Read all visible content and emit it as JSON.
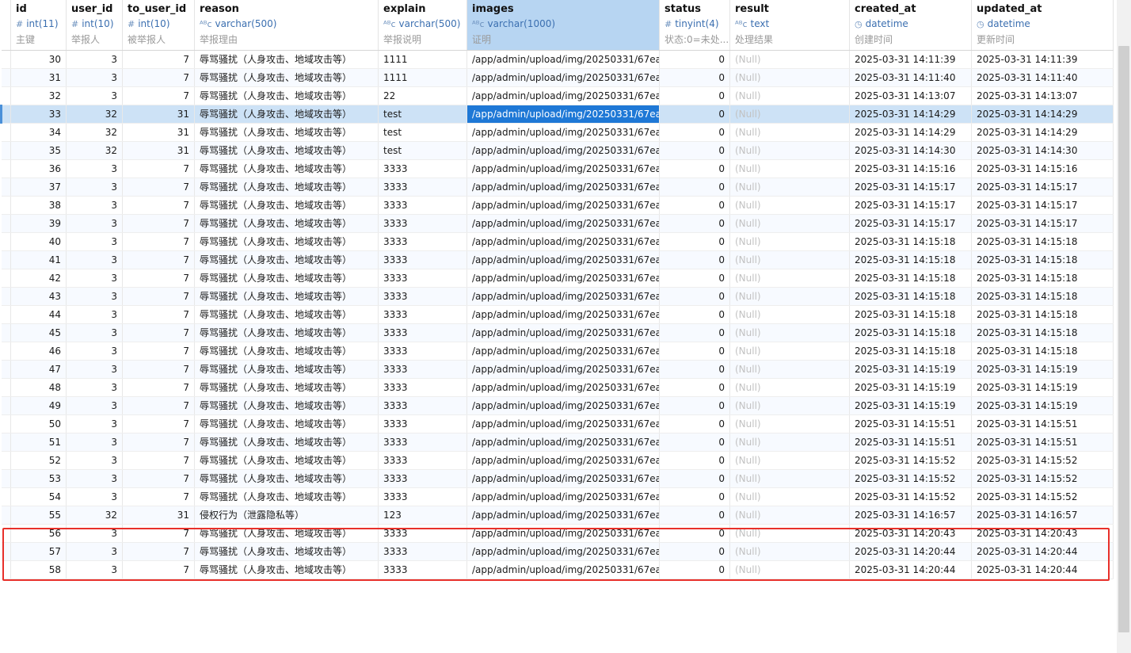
{
  "columns": [
    {
      "name": "id",
      "type": "int(11)",
      "type_icon": "#",
      "comment": "主键",
      "align": "num"
    },
    {
      "name": "user_id",
      "type": "int(10)",
      "type_icon": "#",
      "comment": "举报人",
      "align": "num"
    },
    {
      "name": "to_user_id",
      "type": "int(10)",
      "type_icon": "#",
      "comment": "被举报人",
      "align": "num"
    },
    {
      "name": "reason",
      "type": "varchar(500)",
      "type_icon": "ABC",
      "comment": "举报理由",
      "align": "text"
    },
    {
      "name": "explain",
      "type": "varchar(500)",
      "type_icon": "ABC",
      "comment": "举报说明",
      "align": "text"
    },
    {
      "name": "images",
      "type": "varchar(1000)",
      "type_icon": "ABC",
      "comment": "证明",
      "align": "text"
    },
    {
      "name": "status",
      "type": "tinyint(4)",
      "type_icon": "#",
      "comment": "状态:0=未处...",
      "align": "num"
    },
    {
      "name": "result",
      "type": "text",
      "type_icon": "ABC",
      "comment": "处理结果",
      "align": "text"
    },
    {
      "name": "created_at",
      "type": "datetime",
      "type_icon": "clock",
      "comment": "创建时间",
      "align": "text"
    },
    {
      "name": "updated_at",
      "type": "datetime",
      "type_icon": "clock",
      "comment": "更新时间",
      "align": "text"
    }
  ],
  "selected_column": "images",
  "current_row_id": "33",
  "null_text": "(Null)",
  "rows": [
    [
      "30",
      "3",
      "7",
      "辱骂骚扰（人身攻击、地域攻击等）",
      "1111",
      "/app/admin/upload/img/20250331/67ea",
      "0",
      "(Null)",
      "2025-03-31 14:11:39",
      "2025-03-31 14:11:39"
    ],
    [
      "31",
      "3",
      "7",
      "辱骂骚扰（人身攻击、地域攻击等）",
      "1111",
      "/app/admin/upload/img/20250331/67ea",
      "0",
      "(Null)",
      "2025-03-31 14:11:40",
      "2025-03-31 14:11:40"
    ],
    [
      "32",
      "3",
      "7",
      "辱骂骚扰（人身攻击、地域攻击等）",
      "22",
      "/app/admin/upload/img/20250331/67ea",
      "0",
      "(Null)",
      "2025-03-31 14:13:07",
      "2025-03-31 14:13:07"
    ],
    [
      "33",
      "32",
      "31",
      "辱骂骚扰（人身攻击、地域攻击等）",
      "test",
      "/app/admin/upload/img/20250331/67ea",
      "0",
      "(Null)",
      "2025-03-31 14:14:29",
      "2025-03-31 14:14:29"
    ],
    [
      "34",
      "32",
      "31",
      "辱骂骚扰（人身攻击、地域攻击等）",
      "test",
      "/app/admin/upload/img/20250331/67ea",
      "0",
      "(Null)",
      "2025-03-31 14:14:29",
      "2025-03-31 14:14:29"
    ],
    [
      "35",
      "32",
      "31",
      "辱骂骚扰（人身攻击、地域攻击等）",
      "test",
      "/app/admin/upload/img/20250331/67ea",
      "0",
      "(Null)",
      "2025-03-31 14:14:30",
      "2025-03-31 14:14:30"
    ],
    [
      "36",
      "3",
      "7",
      "辱骂骚扰（人身攻击、地域攻击等）",
      "3333",
      "/app/admin/upload/img/20250331/67ea",
      "0",
      "(Null)",
      "2025-03-31 14:15:16",
      "2025-03-31 14:15:16"
    ],
    [
      "37",
      "3",
      "7",
      "辱骂骚扰（人身攻击、地域攻击等）",
      "3333",
      "/app/admin/upload/img/20250331/67ea",
      "0",
      "(Null)",
      "2025-03-31 14:15:17",
      "2025-03-31 14:15:17"
    ],
    [
      "38",
      "3",
      "7",
      "辱骂骚扰（人身攻击、地域攻击等）",
      "3333",
      "/app/admin/upload/img/20250331/67ea",
      "0",
      "(Null)",
      "2025-03-31 14:15:17",
      "2025-03-31 14:15:17"
    ],
    [
      "39",
      "3",
      "7",
      "辱骂骚扰（人身攻击、地域攻击等）",
      "3333",
      "/app/admin/upload/img/20250331/67ea",
      "0",
      "(Null)",
      "2025-03-31 14:15:17",
      "2025-03-31 14:15:17"
    ],
    [
      "40",
      "3",
      "7",
      "辱骂骚扰（人身攻击、地域攻击等）",
      "3333",
      "/app/admin/upload/img/20250331/67ea",
      "0",
      "(Null)",
      "2025-03-31 14:15:18",
      "2025-03-31 14:15:18"
    ],
    [
      "41",
      "3",
      "7",
      "辱骂骚扰（人身攻击、地域攻击等）",
      "3333",
      "/app/admin/upload/img/20250331/67ea",
      "0",
      "(Null)",
      "2025-03-31 14:15:18",
      "2025-03-31 14:15:18"
    ],
    [
      "42",
      "3",
      "7",
      "辱骂骚扰（人身攻击、地域攻击等）",
      "3333",
      "/app/admin/upload/img/20250331/67ea",
      "0",
      "(Null)",
      "2025-03-31 14:15:18",
      "2025-03-31 14:15:18"
    ],
    [
      "43",
      "3",
      "7",
      "辱骂骚扰（人身攻击、地域攻击等）",
      "3333",
      "/app/admin/upload/img/20250331/67ea",
      "0",
      "(Null)",
      "2025-03-31 14:15:18",
      "2025-03-31 14:15:18"
    ],
    [
      "44",
      "3",
      "7",
      "辱骂骚扰（人身攻击、地域攻击等）",
      "3333",
      "/app/admin/upload/img/20250331/67ea",
      "0",
      "(Null)",
      "2025-03-31 14:15:18",
      "2025-03-31 14:15:18"
    ],
    [
      "45",
      "3",
      "7",
      "辱骂骚扰（人身攻击、地域攻击等）",
      "3333",
      "/app/admin/upload/img/20250331/67ea",
      "0",
      "(Null)",
      "2025-03-31 14:15:18",
      "2025-03-31 14:15:18"
    ],
    [
      "46",
      "3",
      "7",
      "辱骂骚扰（人身攻击、地域攻击等）",
      "3333",
      "/app/admin/upload/img/20250331/67ea",
      "0",
      "(Null)",
      "2025-03-31 14:15:18",
      "2025-03-31 14:15:18"
    ],
    [
      "47",
      "3",
      "7",
      "辱骂骚扰（人身攻击、地域攻击等）",
      "3333",
      "/app/admin/upload/img/20250331/67ea",
      "0",
      "(Null)",
      "2025-03-31 14:15:19",
      "2025-03-31 14:15:19"
    ],
    [
      "48",
      "3",
      "7",
      "辱骂骚扰（人身攻击、地域攻击等）",
      "3333",
      "/app/admin/upload/img/20250331/67ea",
      "0",
      "(Null)",
      "2025-03-31 14:15:19",
      "2025-03-31 14:15:19"
    ],
    [
      "49",
      "3",
      "7",
      "辱骂骚扰（人身攻击、地域攻击等）",
      "3333",
      "/app/admin/upload/img/20250331/67ea",
      "0",
      "(Null)",
      "2025-03-31 14:15:19",
      "2025-03-31 14:15:19"
    ],
    [
      "50",
      "3",
      "7",
      "辱骂骚扰（人身攻击、地域攻击等）",
      "3333",
      "/app/admin/upload/img/20250331/67ea",
      "0",
      "(Null)",
      "2025-03-31 14:15:51",
      "2025-03-31 14:15:51"
    ],
    [
      "51",
      "3",
      "7",
      "辱骂骚扰（人身攻击、地域攻击等）",
      "3333",
      "/app/admin/upload/img/20250331/67ea",
      "0",
      "(Null)",
      "2025-03-31 14:15:51",
      "2025-03-31 14:15:51"
    ],
    [
      "52",
      "3",
      "7",
      "辱骂骚扰（人身攻击、地域攻击等）",
      "3333",
      "/app/admin/upload/img/20250331/67ea",
      "0",
      "(Null)",
      "2025-03-31 14:15:52",
      "2025-03-31 14:15:52"
    ],
    [
      "53",
      "3",
      "7",
      "辱骂骚扰（人身攻击、地域攻击等）",
      "3333",
      "/app/admin/upload/img/20250331/67ea",
      "0",
      "(Null)",
      "2025-03-31 14:15:52",
      "2025-03-31 14:15:52"
    ],
    [
      "54",
      "3",
      "7",
      "辱骂骚扰（人身攻击、地域攻击等）",
      "3333",
      "/app/admin/upload/img/20250331/67ea",
      "0",
      "(Null)",
      "2025-03-31 14:15:52",
      "2025-03-31 14:15:52"
    ],
    [
      "55",
      "32",
      "31",
      "侵权行为（泄露隐私等）",
      "123",
      "/app/admin/upload/img/20250331/67ea",
      "0",
      "(Null)",
      "2025-03-31 14:16:57",
      "2025-03-31 14:16:57"
    ],
    [
      "56",
      "3",
      "7",
      "辱骂骚扰（人身攻击、地域攻击等）",
      "3333",
      "/app/admin/upload/img/20250331/67ea",
      "0",
      "(Null)",
      "2025-03-31 14:20:43",
      "2025-03-31 14:20:43"
    ],
    [
      "57",
      "3",
      "7",
      "辱骂骚扰（人身攻击、地域攻击等）",
      "3333",
      "/app/admin/upload/img/20250331/67ea",
      "0",
      "(Null)",
      "2025-03-31 14:20:44",
      "2025-03-31 14:20:44"
    ],
    [
      "58",
      "3",
      "7",
      "辱骂骚扰（人身攻击、地域攻击等）",
      "3333",
      "/app/admin/upload/img/20250331/67ea",
      "0",
      "(Null)",
      "2025-03-31 14:20:44",
      "2025-03-31 14:20:44"
    ]
  ],
  "highlight": {
    "color": "#e8302a",
    "first_row_id": "56",
    "last_row_id": "58"
  },
  "colors": {
    "selection": "#1e78d6",
    "selected_header": "#b7d5f2",
    "current_row": "#cde2f6",
    "type_text": "#3b6fb0",
    "null_text": "#c2c2c2"
  }
}
